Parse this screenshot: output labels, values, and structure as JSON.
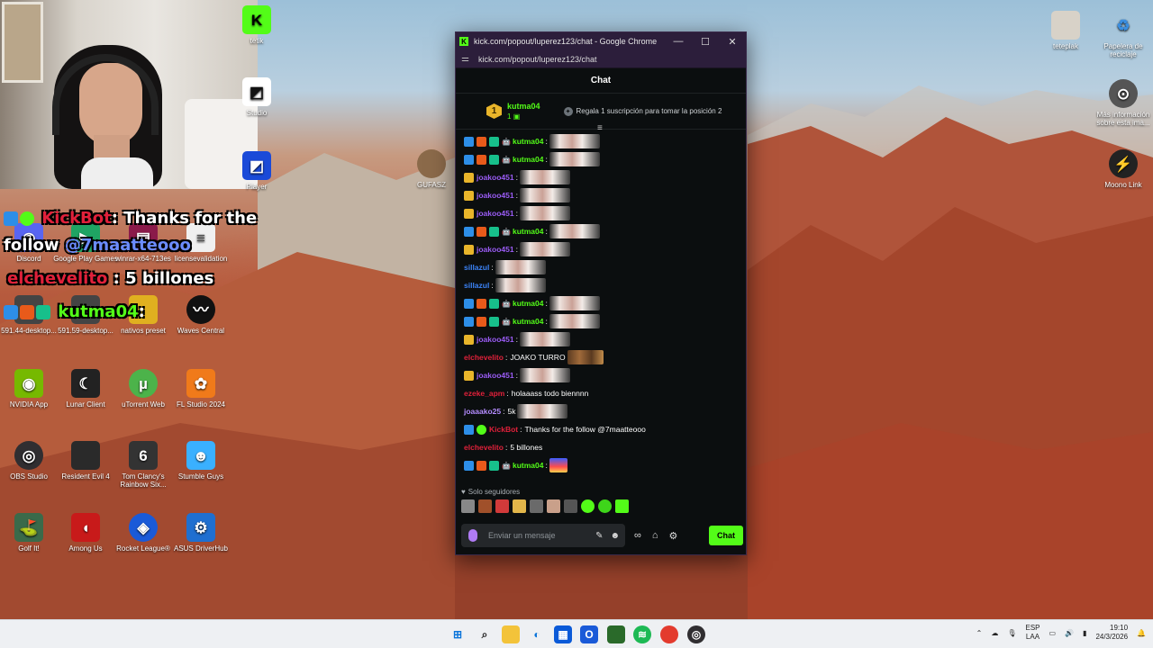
{
  "popup": {
    "window_title": "kick.com/popout/luperez123/chat - Google Chrome",
    "url": "kick.com/popout/luperez123/chat",
    "chat_header": "Chat",
    "pinned": {
      "rank": "1",
      "user": "kutma04",
      "count": "1",
      "gift_text": "Regala 1 suscripción para tomar la posición 2"
    },
    "messages": [
      {
        "user": "kutma04",
        "color": "green",
        "badges": [
          "v",
          "o",
          "s"
        ],
        "emote": true
      },
      {
        "user": "kutma04",
        "color": "green",
        "badges": [
          "v",
          "o",
          "s"
        ],
        "emote": true
      },
      {
        "user": "joakoo451",
        "color": "purple",
        "badges": [
          "g"
        ],
        "emote": true
      },
      {
        "user": "joakoo451",
        "color": "purple",
        "badges": [
          "g"
        ],
        "emote": true
      },
      {
        "user": "joakoo451",
        "color": "purple",
        "badges": [
          "g"
        ],
        "emote": true
      },
      {
        "user": "kutma04",
        "color": "green",
        "badges": [
          "v",
          "o",
          "s"
        ],
        "emote": true
      },
      {
        "user": "joakoo451",
        "color": "purple",
        "badges": [
          "g"
        ],
        "emote": true
      },
      {
        "user": "sillazul",
        "color": "blue",
        "badges": [],
        "emote": true
      },
      {
        "user": "sillazul",
        "color": "blue",
        "badges": [],
        "emote": true
      },
      {
        "user": "kutma04",
        "color": "green",
        "badges": [
          "v",
          "o",
          "s"
        ],
        "emote": true
      },
      {
        "user": "kutma04",
        "color": "green",
        "badges": [
          "v",
          "o",
          "s"
        ],
        "emote": true
      },
      {
        "user": "joakoo451",
        "color": "purple",
        "badges": [
          "g"
        ],
        "emote": true
      },
      {
        "user": "elchevelito",
        "color": "red",
        "badges": [],
        "text": "JOAKO TURRO",
        "emote_small": true
      },
      {
        "user": "joakoo451",
        "color": "purple",
        "badges": [
          "g"
        ],
        "emote": true
      },
      {
        "user": "ezeke_apm",
        "color": "red",
        "badges": [],
        "text": "holaaass todo biennnn"
      },
      {
        "user": "joaaako25",
        "color": "lilac",
        "badges": [],
        "text": "5k",
        "emote": true
      },
      {
        "user": "KickBot",
        "color": "red",
        "badges": [
          "v",
          "k"
        ],
        "text": "Thanks for the follow @7maatteooo"
      },
      {
        "user": "elchevelito",
        "color": "red",
        "badges": [],
        "text": "5 billones"
      },
      {
        "user": "kutma04",
        "color": "green",
        "badges": [
          "v",
          "o",
          "s"
        ],
        "emote_bot": true
      }
    ],
    "followers_only": "Solo seguidores",
    "input_placeholder": "Enviar un mensaje",
    "chat_button": "Chat"
  },
  "overlay": {
    "kickbot_user": "KickBot",
    "kickbot_text": "Thanks for the",
    "kickbot_text2": "follow",
    "kickbot_mention": "@7maatteooo",
    "chevelito_user": "elchevelito",
    "chevelito_text": "5 billones",
    "kutma_user": "kutma04"
  },
  "desktop_icons": [
    {
      "label": "teteplak",
      "color": "#d8d2c8"
    },
    {
      "label": "Papelera de reciclaje",
      "color": "#3a8ee0"
    },
    {
      "label": "Más información sobre esta ima...",
      "color": "#555"
    },
    {
      "label": "Moono Link",
      "color": "#222"
    },
    {
      "label": "Discord",
      "color": "#5865f2"
    },
    {
      "label": "Google Play Games",
      "color": "#1fa463"
    },
    {
      "label": "winrar-x64-713es",
      "color": "#8b1a4a"
    },
    {
      "label": "licensevalidation",
      "color": "#f0f0f0"
    },
    {
      "label": "591.44-desktop...",
      "color": "#444"
    },
    {
      "label": "591.59-desktop...",
      "color": "#444"
    },
    {
      "label": "nativos preset",
      "color": "#e0b020"
    },
    {
      "label": "Waves Central",
      "color": "#111"
    },
    {
      "label": "NVIDIA App",
      "color": "#76b900"
    },
    {
      "label": "Lunar Client",
      "color": "#222"
    },
    {
      "label": "uTorrent Web",
      "color": "#4cb34a"
    },
    {
      "label": "FL Studio 2024",
      "color": "#f07a1a"
    },
    {
      "label": "OBS Studio",
      "color": "#302e31"
    },
    {
      "label": "Resident Evil 4",
      "color": "#2a2a2a"
    },
    {
      "label": "Tom Clancy's Rainbow Six...",
      "color": "#333"
    },
    {
      "label": "Stumble Guys",
      "color": "#3ab0ff"
    },
    {
      "label": "Golf It!",
      "color": "#3a6a4a"
    },
    {
      "label": "Among Us",
      "color": "#c81a1a"
    },
    {
      "label": "Rocket League®",
      "color": "#1a5ad8"
    },
    {
      "label": "ASUS DriverHub",
      "color": "#1f6fd0"
    },
    {
      "label": "Studio",
      "color": "#fff"
    },
    {
      "label": "Player",
      "color": "#1a4ad8"
    },
    {
      "label": "GUFASZ",
      "color": "#8b6a4a"
    },
    {
      "label": "tetik",
      "color": "#53fc18"
    }
  ],
  "taskbar": {
    "lang_top": "ESP",
    "lang_bottom": "LAA",
    "time": "19:10",
    "date": "24/3/2026"
  }
}
